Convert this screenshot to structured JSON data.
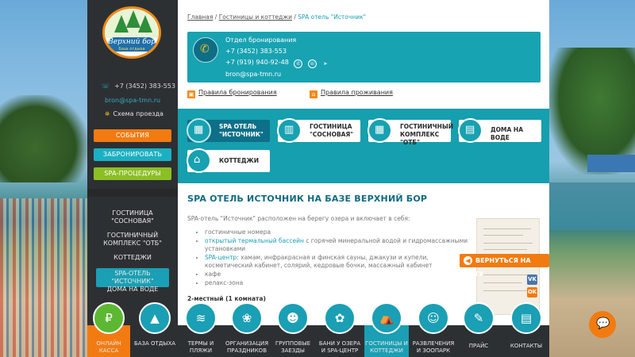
{
  "sidebar": {
    "logo_text": "Верхний бор",
    "logo_sub": "База отдыха",
    "phone": "+7 (3452) 383-553",
    "email": "bron@spa-tmn.ru",
    "map_link": "Схема проезда",
    "buttons": {
      "events": "СОБЫТИЯ",
      "book": "ЗАБРОНИРОВАТЬ",
      "spa": "SPA-ПРОЦЕДУРЫ"
    },
    "nav": [
      {
        "label": "ГОСТИНИЦА \"СОСНОВАЯ\""
      },
      {
        "label": "ГОСТИНИЧНЫЙ КОМПЛЕКС \"ОТБ\""
      },
      {
        "label": "КОТТЕДЖИ"
      },
      {
        "label": "SPA-ОТЕЛЬ \"ИСТОЧНИК\""
      },
      {
        "label": "ДОМА НА ВОДЕ"
      }
    ]
  },
  "breadcrumb": {
    "home": "Главная",
    "sep": " / ",
    "section": "Гостиницы и коттеджи",
    "current": "SPA отель \"Источник\""
  },
  "contact": {
    "title": "Отдел бронирования",
    "phone1": "+7 (3452) 383-553",
    "phone2": "+7 (919) 940-92-48",
    "email": "bron@spa-tmn.ru"
  },
  "rules": {
    "booking": "Правила бронирования",
    "stay": "Правила проживания"
  },
  "categories": [
    {
      "label": "SPA ОТЕЛЬ \"ИСТОЧНИК\""
    },
    {
      "label": "ГОСТИНИЦА \"СОСНОВАЯ\""
    },
    {
      "label": "ГОСТИНИЧНЫЙ КОМПЛЕКС \"ОТБ\""
    },
    {
      "label": "ДОМА НА ВОДЕ"
    },
    {
      "label": "КОТТЕДЖИ"
    }
  ],
  "content": {
    "heading": "SPA ОТЕЛЬ ИСТОЧНИК НА БАЗЕ ВЕРХНИЙ БОР",
    "intro": "SPA-отель \"Источник\" расположен на берегу озера и включает в себя:",
    "features": {
      "rooms": "гостиничные номера",
      "pool_link": "открытый термальный бассейн",
      "pool_rest": " с горячей минеральной водой и гидромассажными установками",
      "spa_link": "SPA-центр",
      "spa_rest": ": хамам, инфракрасная и финская сауны, джакузи и купели, косметический кабинет, солярий, кедровые бочки, массажный кабинет",
      "cafe": "кафе",
      "relax": "релакс-зона"
    },
    "room_type": "2-местный (1 комната)"
  },
  "back_to_map": "ВЕРНУТЬСЯ НА КАРТУ",
  "social": {
    "vk": "VK",
    "ok": "OK"
  },
  "bottom_nav": [
    {
      "label": "ОНЛАЙН КАССА"
    },
    {
      "label": "БАЗА ОТДЫХА"
    },
    {
      "label": "ТЕРМЫ И ПЛЯЖИ"
    },
    {
      "label": "ОРГАНИЗАЦИЯ ПРАЗДНИКОВ"
    },
    {
      "label": "ГРУППОВЫЕ ЗАЕЗДЫ"
    },
    {
      "label": "БАНИ У ОЗЕРА И SPA-ЦЕНТР"
    },
    {
      "label": "ГОСТИНИЦЫ И КОТТЕДЖИ"
    },
    {
      "label": "РАЗВЛЕЧЕНИЯ И ЗООПАРК"
    },
    {
      "label": "ПРАЙС"
    },
    {
      "label": "КОНТАКТЫ"
    }
  ],
  "colors": {
    "teal": "#1a9fb4",
    "orange": "#f27b11",
    "green": "#8bbf24",
    "dark": "#2d3033"
  }
}
